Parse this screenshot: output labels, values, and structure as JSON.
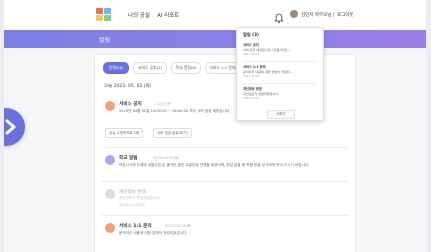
{
  "colors": {
    "accent": "#6b70e0",
    "band_start": "#7b80e6",
    "band_end": "#9a7ee8",
    "icon_purple": "#a9abf0",
    "icon_orange": "#f2a07a",
    "icon_gray": "#dcdce2"
  },
  "nav": {
    "links": [
      "나의 공실",
      "AI 리포트"
    ],
    "user_label": "김민지 학부모님",
    "logout_label": "로그아웃"
  },
  "header": {
    "title": "알림"
  },
  "tabs": [
    "전체(26)",
    "서비스 공지(2)",
    "학교 알림(6)",
    "서비스 1:1 문의(8)"
  ],
  "date_header": "오늘 2023. 05. 02 (화)",
  "items": [
    {
      "title": "서비스 공지",
      "time": "1시간 전",
      "body": "2023년 04월 02일 14:00:00 ~ 16:00:00 까지 서버 점검 예정입니다.",
      "tags": [
        "공실 고정학프로그램",
        "서버 점검 완료(보기)"
      ],
      "icon": "megaphone-icon"
    },
    {
      "title": "학교 알림",
      "time": "2023.04.03(화)",
      "body": "보본니가에 인쇄에 계발사업 온 출석인 중인 요일인에 전체할 예정이며, 부담 없을 때 학원 등을 상가에게 문이 오시기 바랍니다.",
      "icon": "school-icon"
    },
    {
      "title": "개인정보 변경",
      "time": "2023.04.04(토)",
      "body": "개인정보가 변경되었습니다.",
      "icon": "user-icon",
      "disabled": true
    },
    {
      "title": "서비스 1:1 문의",
      "time": "2023.04.13(화)",
      "body": "문의하신 내용에 대한 답변이 작성되었습니다.",
      "icon": "chat-icon"
    }
  ],
  "popup": {
    "title": "알림 (3)",
    "items": [
      {
        "title": "서비스 공지",
        "body": "서버 점검 예정입니다. 04월 02일 ...",
        "date": "2023.04.03"
      },
      {
        "title": "서비스 1:1 문의",
        "body": "문의하신 내용에 대한 답변이 작성되...",
        "date": "2023.04.03"
      },
      {
        "title": "개인정보 변경",
        "body": "개인정보가 변경되었습니다.",
        "date": "2023.04.03"
      }
    ],
    "more_label": "더보기"
  }
}
